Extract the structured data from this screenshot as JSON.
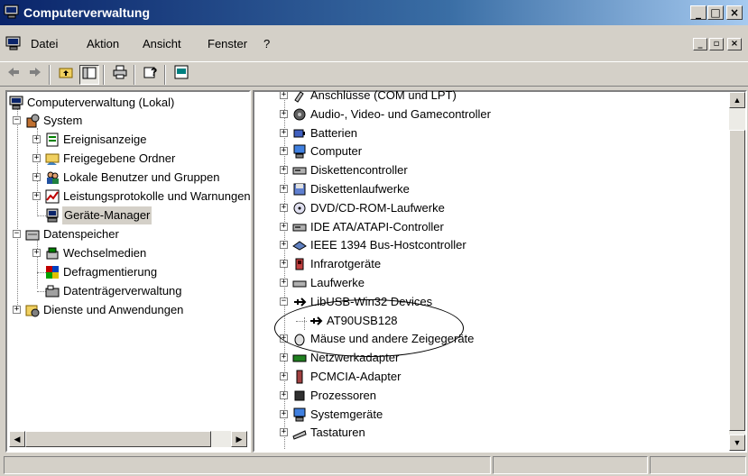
{
  "window": {
    "title": "Computerverwaltung",
    "controls": [
      "_",
      "□",
      "×"
    ]
  },
  "menu": {
    "items": [
      "Datei",
      "Aktion",
      "Ansicht",
      "Fenster",
      "?"
    ],
    "mdi_controls": [
      "_",
      "▫",
      "×"
    ]
  },
  "toolbar": {
    "buttons": [
      "back-icon",
      "forward-icon",
      "up-folder-icon",
      "show-hide-tree-icon",
      "print-icon",
      "help-icon",
      "console-icon"
    ]
  },
  "left_tree": {
    "root": "Computerverwaltung (Lokal)",
    "system": "System",
    "system_children": [
      "Ereignisanzeige",
      "Freigegebene Ordner",
      "Lokale Benutzer und Gruppen",
      "Leistungsprotokolle und Warnungen",
      "Geräte-Manager"
    ],
    "storage": "Datenspeicher",
    "storage_children": [
      "Wechselmedien",
      "Defragmentierung",
      "Datenträgerverwaltung"
    ],
    "services": "Dienste und Anwendungen",
    "selected": "Geräte-Manager"
  },
  "device_tree": {
    "categories": [
      "Anschlüsse (COM und LPT)",
      "Audio-, Video- und Gamecontroller",
      "Batterien",
      "Computer",
      "Diskettencontroller",
      "Diskettenlaufwerke",
      "DVD/CD-ROM-Laufwerke",
      "IDE ATA/ATAPI-Controller",
      "IEEE 1394 Bus-Hostcontroller",
      "Infrarotgeräte",
      "Laufwerke",
      "LibUSB-Win32 Devices"
    ],
    "libusb_child": "AT90USB128",
    "categories_after": [
      "Mäuse und andere Zeigegeräte",
      "Netzwerkadapter",
      "PCMCIA-Adapter",
      "Prozessoren",
      "Systemgeräte",
      "Tastaturen"
    ]
  },
  "colors": {
    "title_start": "#0a246a",
    "title_end": "#a6caf0",
    "face": "#d4d0c8",
    "annotation": "#000000"
  }
}
